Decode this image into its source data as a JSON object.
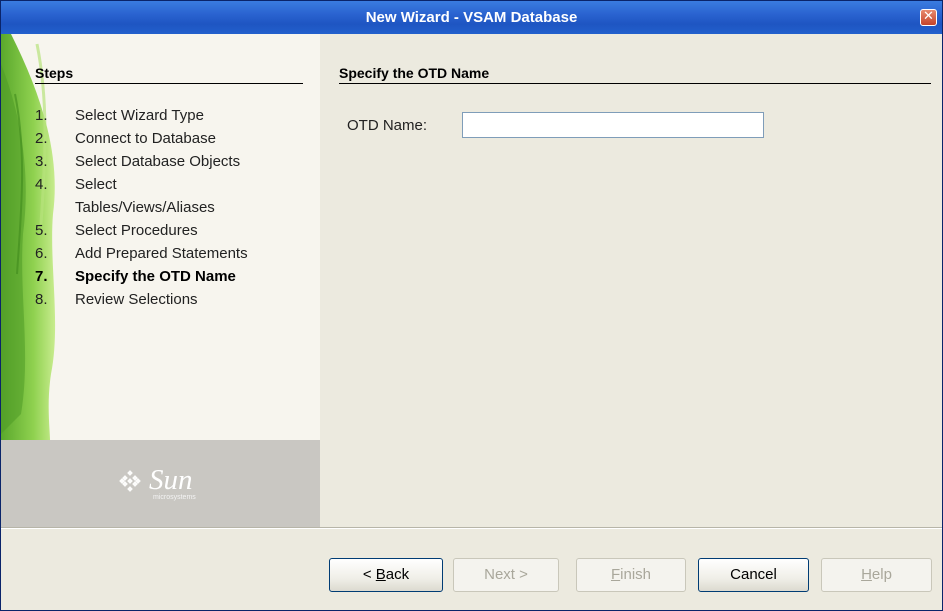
{
  "window": {
    "title": "New Wizard - VSAM Database",
    "close_glyph": "✕"
  },
  "steps": {
    "title": "Steps",
    "items": [
      {
        "num": "1.",
        "label": "Select Wizard Type"
      },
      {
        "num": "2.",
        "label": "Connect to Database"
      },
      {
        "num": "3.",
        "label": "Select Database Objects"
      },
      {
        "num": "4.",
        "label": "Select Tables/Views/Aliases"
      },
      {
        "num": "5.",
        "label": "Select Procedures"
      },
      {
        "num": "6.",
        "label": "Add Prepared Statements"
      },
      {
        "num": "7.",
        "label": "Specify the OTD Name"
      },
      {
        "num": "8.",
        "label": "Review Selections"
      }
    ],
    "active_index": 6
  },
  "brand": {
    "name": "Sun",
    "sub": "microsystems"
  },
  "main": {
    "section_title": "Specify the OTD Name",
    "otd_label": "OTD Name:",
    "otd_value": ""
  },
  "buttons": {
    "back": {
      "prefix": "< ",
      "mnemonic": "B",
      "rest": "ack",
      "enabled": true
    },
    "next": {
      "label": "Next >",
      "enabled": false
    },
    "finish": {
      "mnemonic": "F",
      "rest": "inish",
      "enabled": false
    },
    "cancel": {
      "label": "Cancel",
      "enabled": true
    },
    "help": {
      "mnemonic": "H",
      "rest": "elp",
      "enabled": false
    }
  },
  "colors": {
    "title_bar": "#2a63d0",
    "panel_bg": "#eceadf",
    "leaf_green": "#7cc242",
    "brand_gray": "#c9c7c2"
  }
}
